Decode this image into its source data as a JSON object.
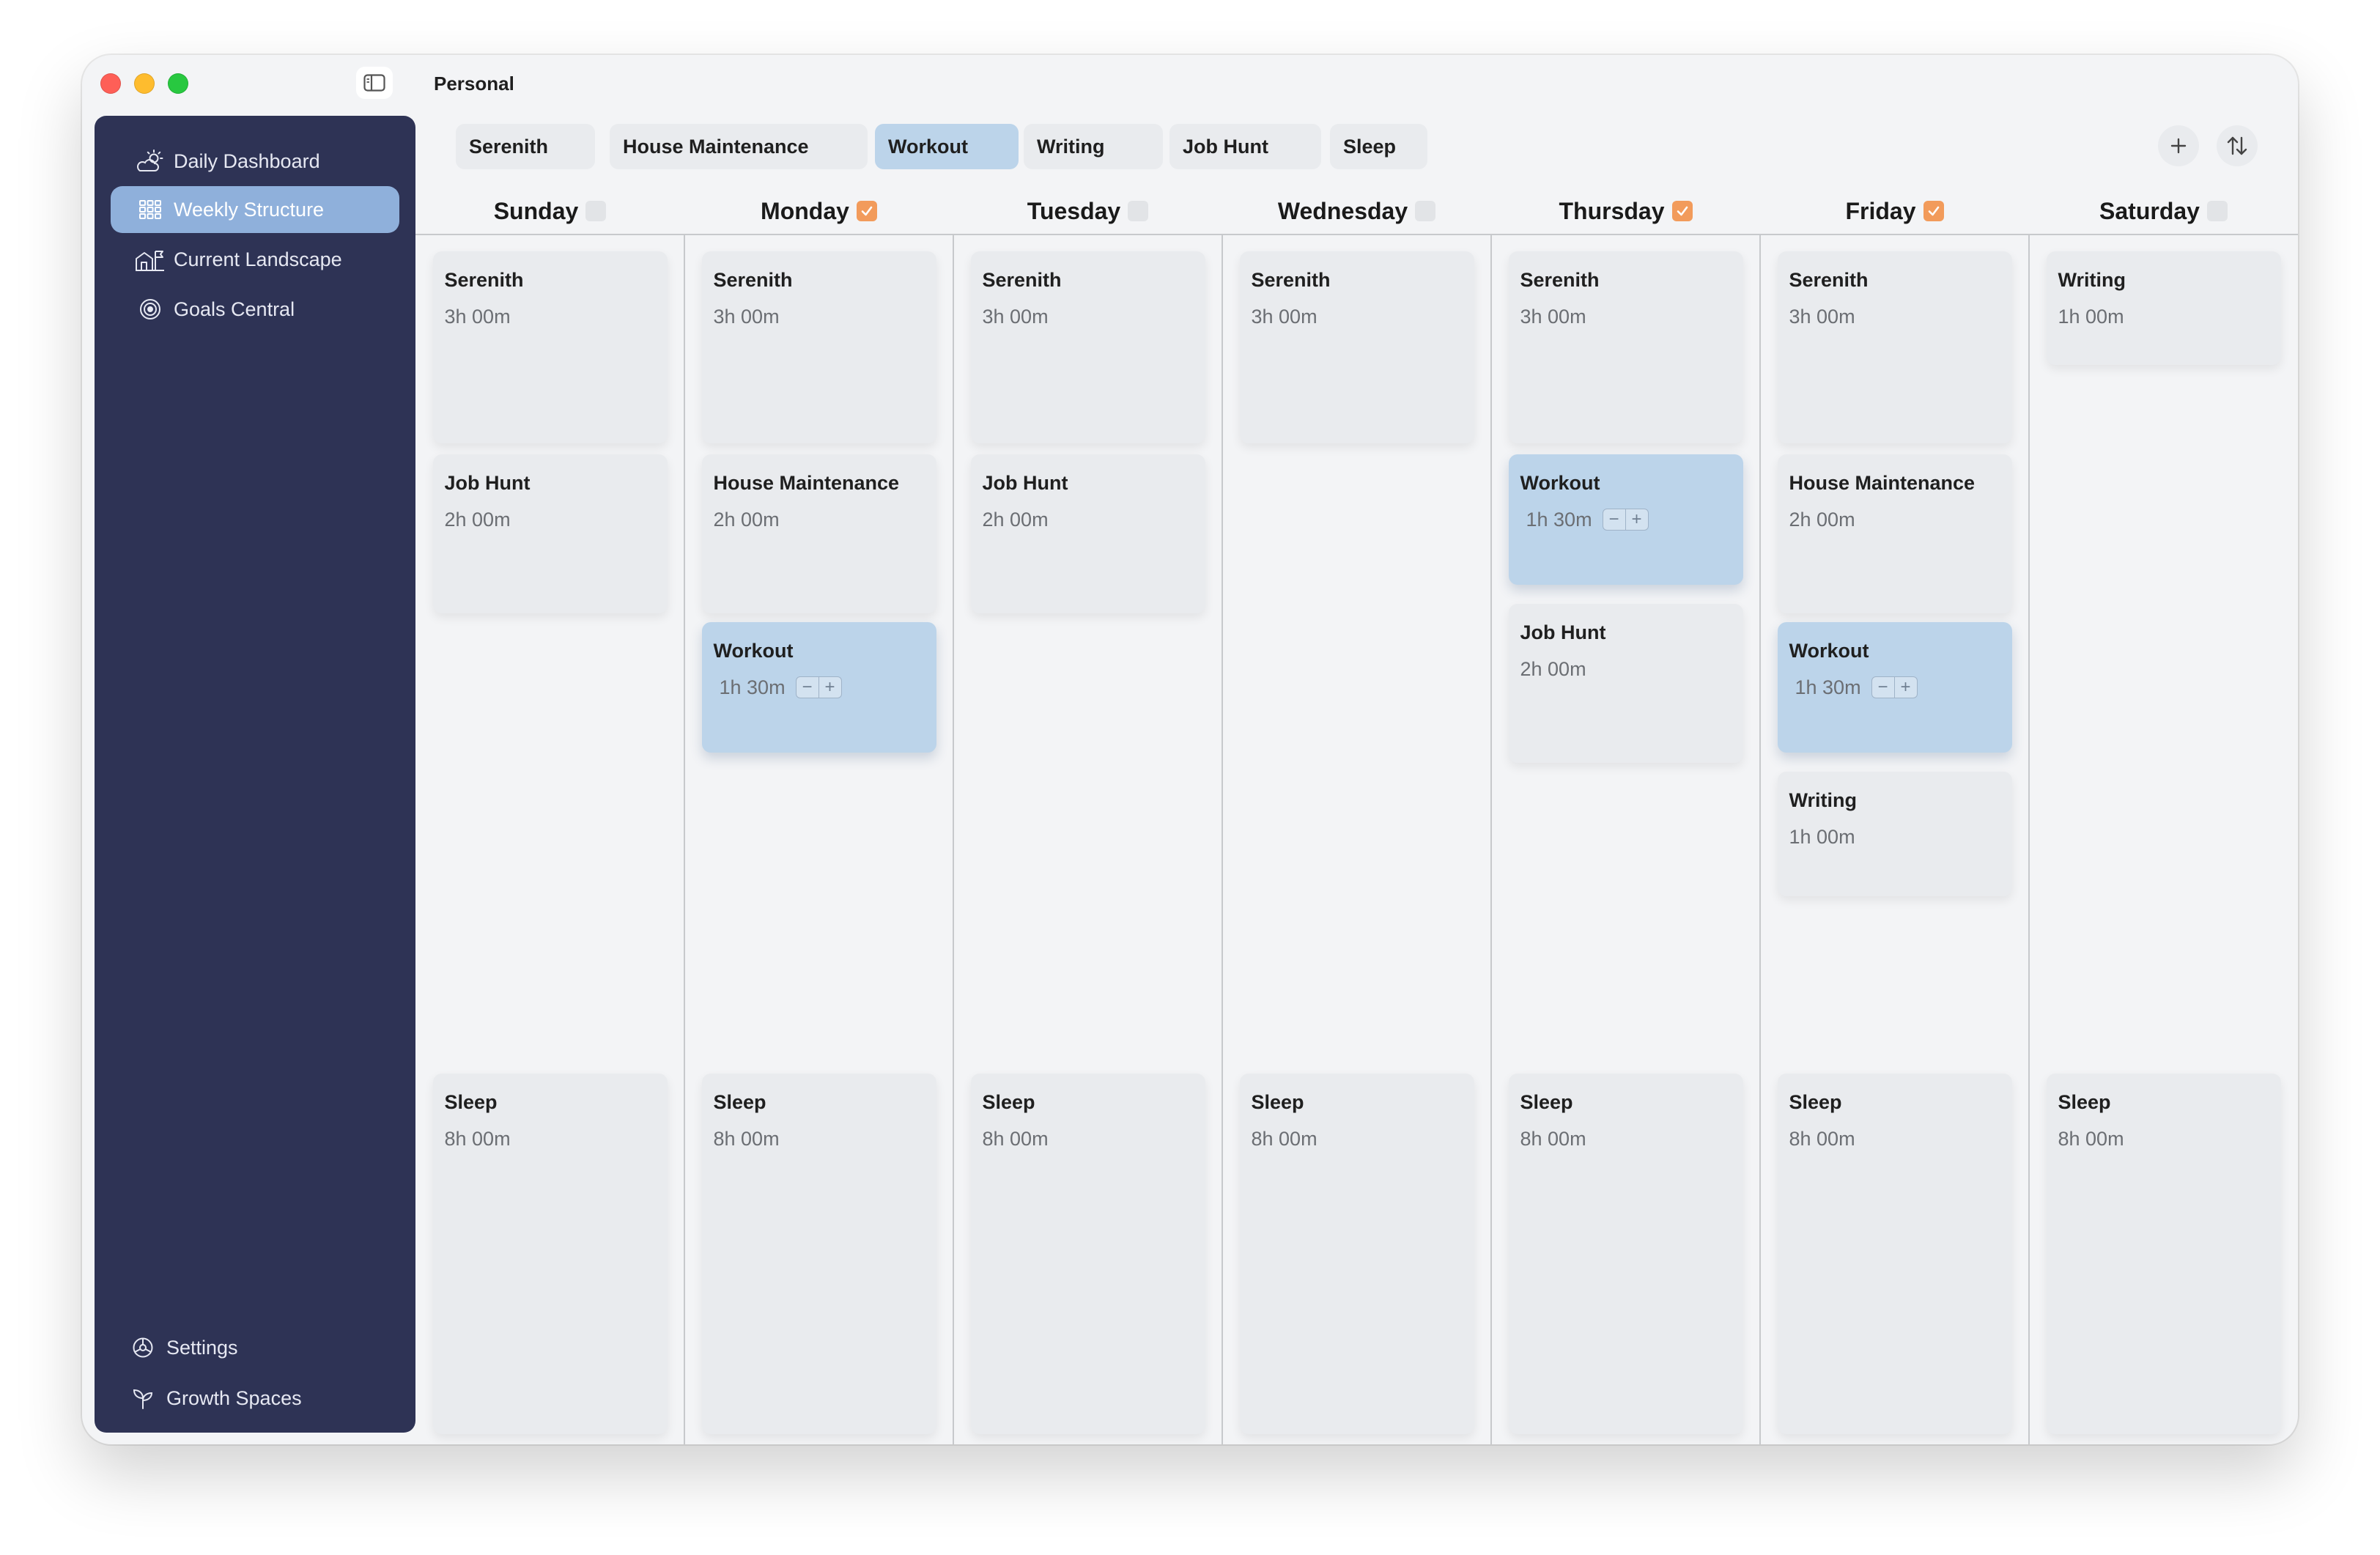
{
  "window": {
    "title": "Personal"
  },
  "sidebar": {
    "items": [
      {
        "label": "Daily Dashboard",
        "icon": "sun-cloud-icon",
        "active": false
      },
      {
        "label": "Weekly Structure",
        "icon": "grid-icon",
        "active": true
      },
      {
        "label": "Current Landscape",
        "icon": "landscape-icon",
        "active": false
      },
      {
        "label": "Goals Central",
        "icon": "target-icon",
        "active": false
      }
    ],
    "bottom": [
      {
        "label": "Settings",
        "icon": "settings-icon"
      },
      {
        "label": "Growth Spaces",
        "icon": "sprout-icon"
      }
    ]
  },
  "tabs": [
    {
      "label": "Serenith",
      "active": false
    },
    {
      "label": "House Maintenance",
      "active": false
    },
    {
      "label": "Workout",
      "active": true
    },
    {
      "label": "Writing",
      "active": false
    },
    {
      "label": "Job Hunt",
      "active": false
    },
    {
      "label": "Sleep",
      "active": false
    }
  ],
  "toolbar": {
    "add_icon": "plus-icon",
    "sort_icon": "sort-arrows-icon"
  },
  "days": [
    {
      "name": "Sunday",
      "checked": false,
      "blocks": [
        {
          "title": "Serenith",
          "duration": "3h 00m"
        },
        {
          "title": "Job Hunt",
          "duration": "2h 00m"
        },
        {
          "title": "Sleep",
          "duration": "8h 00m"
        }
      ]
    },
    {
      "name": "Monday",
      "checked": true,
      "blocks": [
        {
          "title": "Serenith",
          "duration": "3h 00m"
        },
        {
          "title": "House Maintenance",
          "duration": "2h 00m"
        },
        {
          "title": "Workout",
          "duration": "1h 30m",
          "highlight": true
        },
        {
          "title": "Sleep",
          "duration": "8h 00m"
        }
      ]
    },
    {
      "name": "Tuesday",
      "checked": false,
      "blocks": [
        {
          "title": "Serenith",
          "duration": "3h 00m"
        },
        {
          "title": "Job Hunt",
          "duration": "2h 00m"
        },
        {
          "title": "Sleep",
          "duration": "8h 00m"
        }
      ]
    },
    {
      "name": "Wednesday",
      "checked": false,
      "blocks": [
        {
          "title": "Serenith",
          "duration": "3h 00m"
        },
        {
          "title": "Sleep",
          "duration": "8h 00m"
        }
      ]
    },
    {
      "name": "Thursday",
      "checked": true,
      "blocks": [
        {
          "title": "Serenith",
          "duration": "3h 00m"
        },
        {
          "title": "Workout",
          "duration": "1h 30m",
          "highlight": true
        },
        {
          "title": "Job Hunt",
          "duration": "2h 00m"
        },
        {
          "title": "Sleep",
          "duration": "8h 00m"
        }
      ]
    },
    {
      "name": "Friday",
      "checked": true,
      "blocks": [
        {
          "title": "Serenith",
          "duration": "3h 00m"
        },
        {
          "title": "House Maintenance",
          "duration": "2h 00m"
        },
        {
          "title": "Workout",
          "duration": "1h 30m",
          "highlight": true
        },
        {
          "title": "Writing",
          "duration": "1h 00m"
        },
        {
          "title": "Sleep",
          "duration": "8h 00m"
        }
      ]
    },
    {
      "name": "Saturday",
      "checked": false,
      "blocks": [
        {
          "title": "Writing",
          "duration": "1h 00m"
        },
        {
          "title": "Sleep",
          "duration": "8h 00m"
        }
      ]
    }
  ],
  "stepper": {
    "minus": "−",
    "plus": "+"
  },
  "colors": {
    "sidebar": "#2e3355",
    "active_nav": "#8fb0db",
    "highlight_block": "#bcd4ea",
    "block": "#e9ebee",
    "checked": "#f29b5b"
  }
}
